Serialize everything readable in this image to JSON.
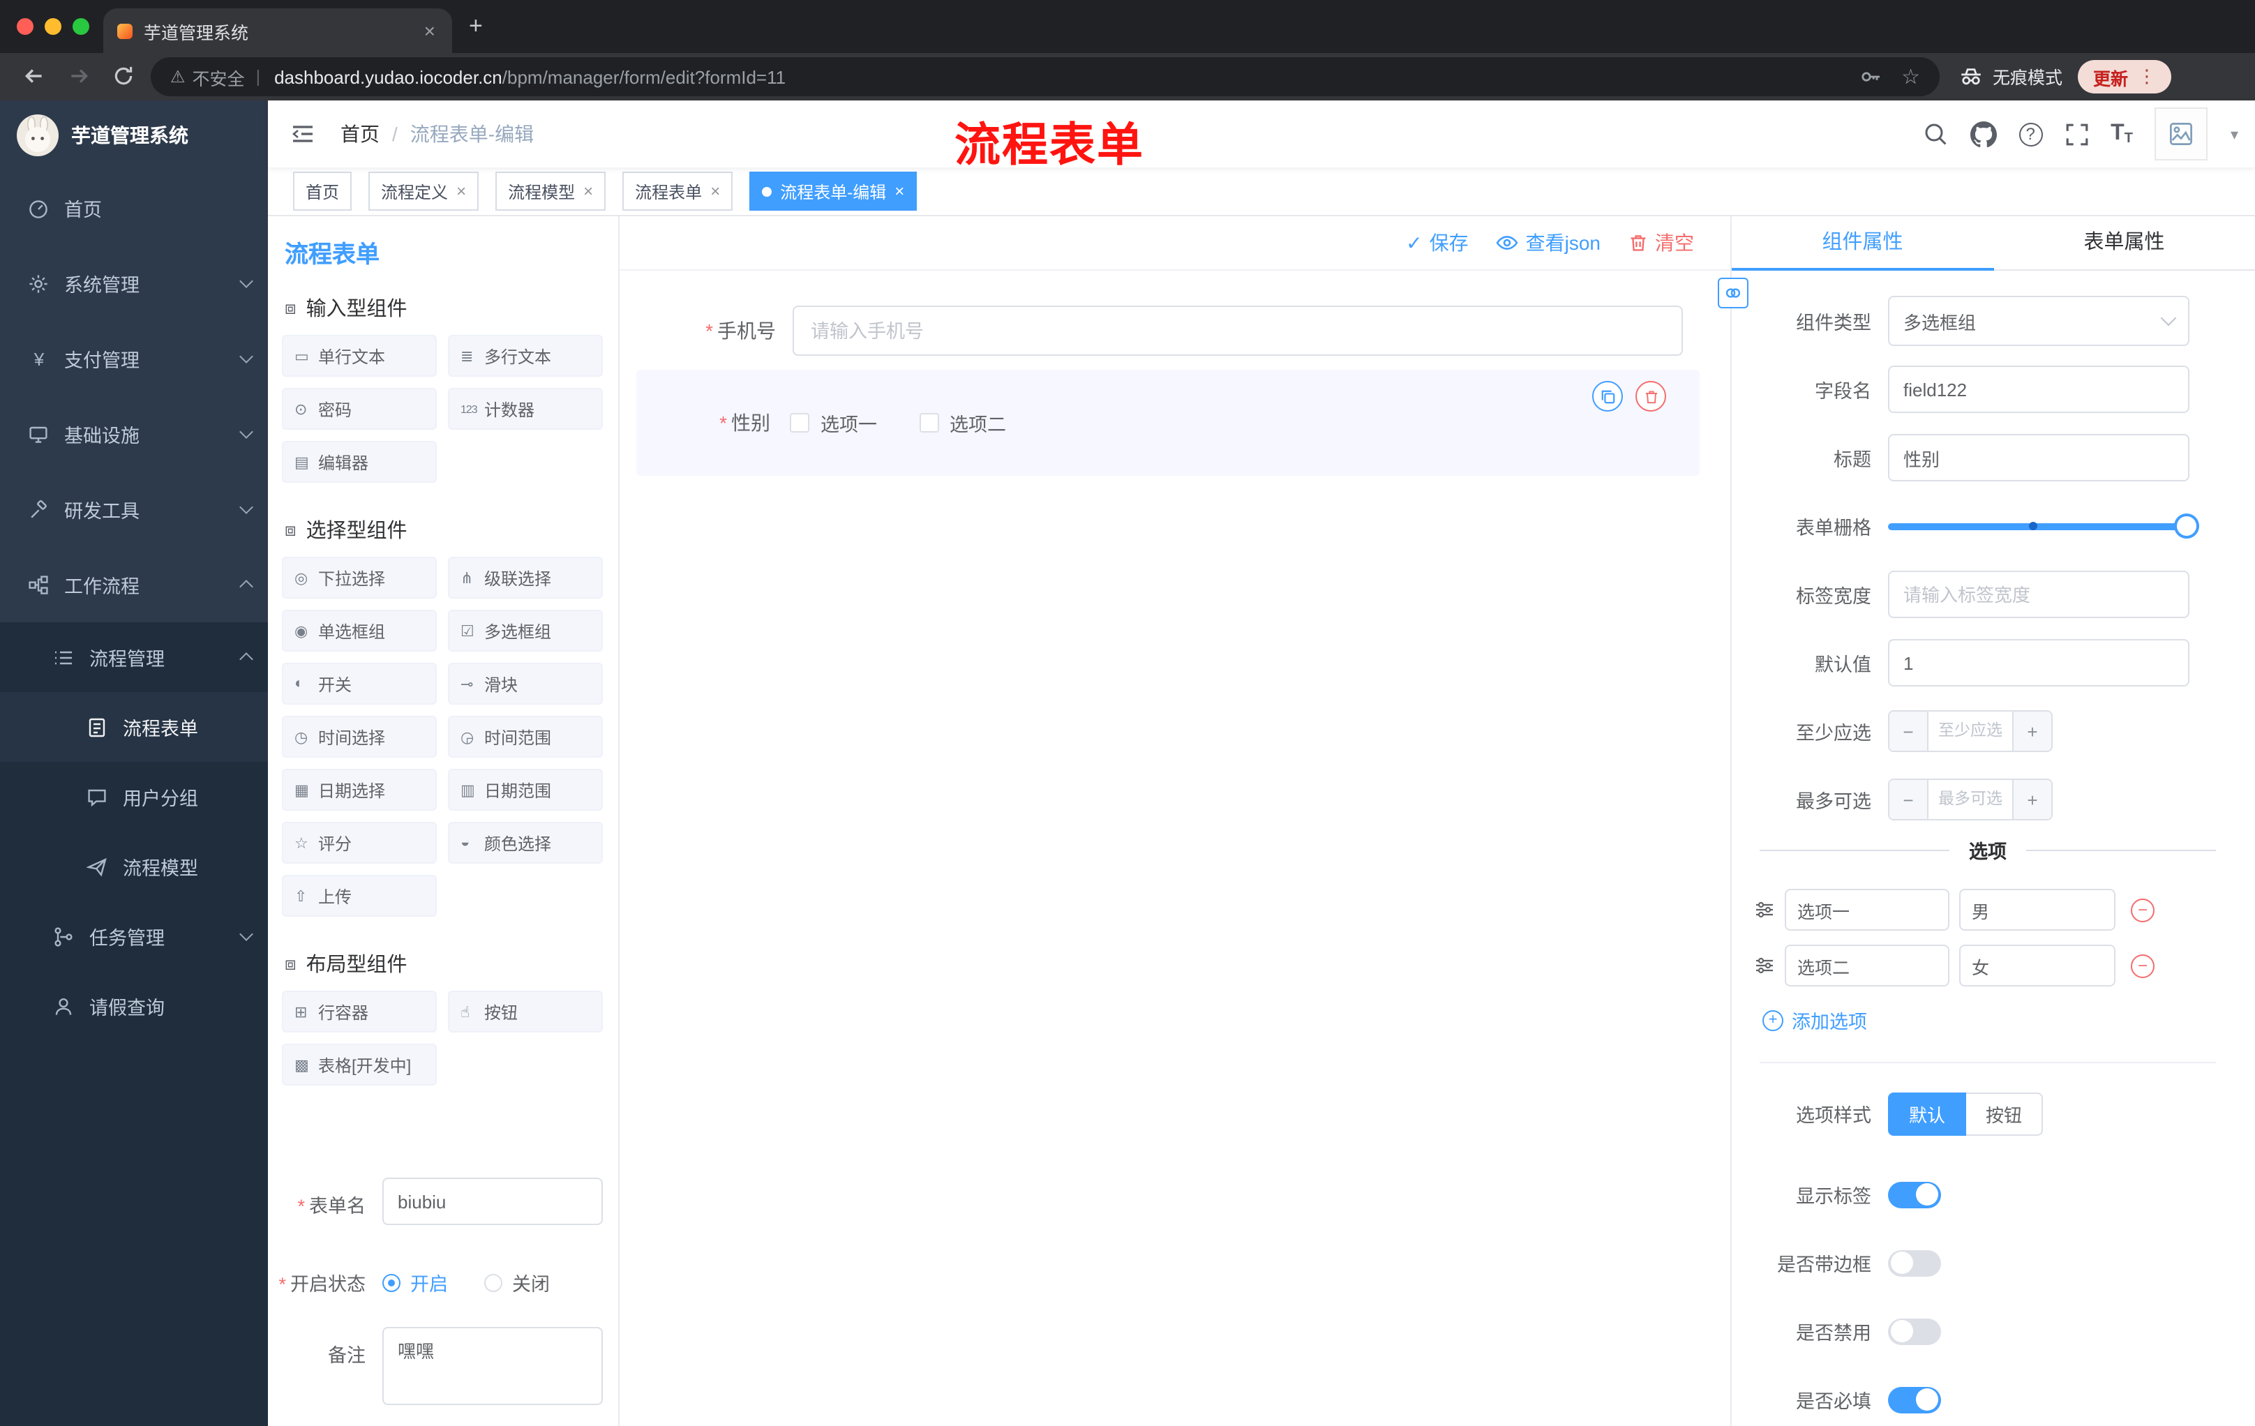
{
  "glyphs": {
    "star": "*",
    "close": "×",
    "plus": "+",
    "minus": "−",
    "kebab": "⋮",
    "caret": "▾",
    "check": "✓",
    "question": "?",
    "pipe": "|",
    "warning": "⚠",
    "fav_star": "☆",
    "tsize": "T"
  },
  "browser": {
    "tab_title": "芋道管理系统",
    "security": "不安全",
    "domain": "dashboard.yudao.iocoder.cn",
    "path": "/bpm/manager/form/edit?formId=11",
    "incognito": "无痕模式",
    "update": "更新"
  },
  "sidebar": {
    "logo": "芋道管理系统",
    "items": [
      {
        "label": "首页"
      },
      {
        "label": "系统管理"
      },
      {
        "label": "支付管理"
      },
      {
        "label": "基础设施"
      },
      {
        "label": "研发工具"
      },
      {
        "label": "工作流程"
      },
      {
        "label": "流程管理"
      },
      {
        "label": "流程表单"
      },
      {
        "label": "用户分组"
      },
      {
        "label": "流程模型"
      },
      {
        "label": "任务管理"
      },
      {
        "label": "请假查询"
      }
    ]
  },
  "header": {
    "breadcrumb_home": "首页",
    "breadcrumb_current": "流程表单-编辑",
    "annotation": "流程表单"
  },
  "tags": {
    "items": [
      {
        "label": "首页"
      },
      {
        "label": "流程定义"
      },
      {
        "label": "流程模型"
      },
      {
        "label": "流程表单"
      },
      {
        "label": "流程表单-编辑"
      }
    ]
  },
  "palette": {
    "title": "流程表单",
    "groups": [
      {
        "title": "输入型组件",
        "items": [
          {
            "icon": "▭",
            "label": "单行文本"
          },
          {
            "icon": "≣",
            "label": "多行文本"
          },
          {
            "icon": "⊙",
            "label": "密码"
          },
          {
            "icon": "123",
            "label": "计数器"
          },
          {
            "icon": "▤",
            "label": "编辑器"
          }
        ]
      },
      {
        "title": "选择型组件",
        "items": [
          {
            "icon": "◎",
            "label": "下拉选择"
          },
          {
            "icon": "⋔",
            "label": "级联选择"
          },
          {
            "icon": "◉",
            "label": "单选框组"
          },
          {
            "icon": "☑",
            "label": "多选框组"
          },
          {
            "icon": "◐",
            "label": "开关"
          },
          {
            "icon": "⊸",
            "label": "滑块"
          },
          {
            "icon": "◷",
            "label": "时间选择"
          },
          {
            "icon": "◶",
            "label": "时间范围"
          },
          {
            "icon": "▦",
            "label": "日期选择"
          },
          {
            "icon": "▥",
            "label": "日期范围"
          },
          {
            "icon": "☆",
            "label": "评分"
          },
          {
            "icon": "◒",
            "label": "颜色选择"
          },
          {
            "icon": "⇧",
            "label": "上传"
          }
        ]
      },
      {
        "title": "布局型组件",
        "items": [
          {
            "icon": "⊞",
            "label": "行容器"
          },
          {
            "icon": "☝",
            "label": "按钮"
          },
          {
            "icon": "▩",
            "label": "表格[开发中]"
          }
        ]
      }
    ],
    "form": {
      "name_label": "表单名",
      "name_value": "biubiu",
      "status_label": "开启状态",
      "status_on": "开启",
      "status_off": "关闭",
      "remark_label": "备注",
      "remark_value": "嘿嘿"
    }
  },
  "canvas": {
    "toolbar": {
      "save": "保存",
      "view": "查看json",
      "clear": "清空"
    },
    "phone_label": "手机号",
    "phone_placeholder": "请输入手机号",
    "gender_label": "性别",
    "gender_opt1": "选项一",
    "gender_opt2": "选项二"
  },
  "props": {
    "tab_component": "组件属性",
    "tab_form": "表单属性",
    "type_label": "组件类型",
    "type_value": "多选框组",
    "field_label": "字段名",
    "field_value": "field122",
    "title_label": "标题",
    "title_value": "性别",
    "grid_label": "表单栅格",
    "width_label": "标签宽度",
    "width_placeholder": "请输入标签宽度",
    "default_label": "默认值",
    "default_value": "1",
    "min_label": "至少应选",
    "min_placeholder": "至少应选",
    "max_label": "最多可选",
    "max_placeholder": "最多可选",
    "options_divider": "选项",
    "options": [
      {
        "label": "选项一",
        "value": "男"
      },
      {
        "label": "选项二",
        "value": "女"
      }
    ],
    "add_option": "添加选项",
    "style_label": "选项样式",
    "style_default": "默认",
    "style_button": "按钮",
    "switch_show_label": "显示标签",
    "switch_border": "是否带边框",
    "switch_disabled": "是否禁用",
    "switch_required": "是否必填"
  }
}
